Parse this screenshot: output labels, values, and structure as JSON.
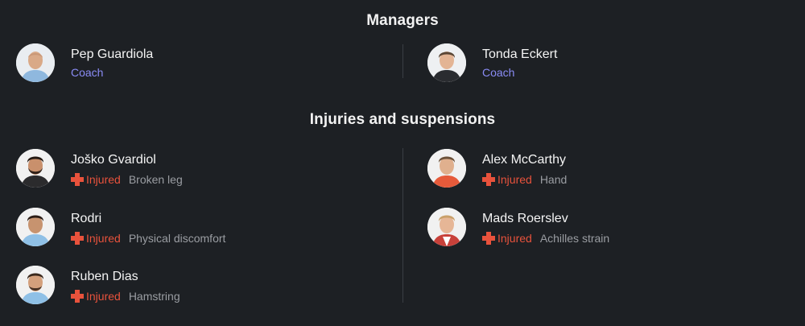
{
  "managers": {
    "title": "Managers",
    "left": {
      "name": "Pep Guardiola",
      "role": "Coach"
    },
    "right": {
      "name": "Tonda Eckert",
      "role": "Coach"
    }
  },
  "injuries": {
    "title": "Injuries and suspensions",
    "left": [
      {
        "name": "Joško Gvardiol",
        "status": "Injured",
        "reason": "Broken leg"
      },
      {
        "name": "Rodri",
        "status": "Injured",
        "reason": "Physical discomfort"
      },
      {
        "name": "Ruben Dias",
        "status": "Injured",
        "reason": "Hamstring"
      }
    ],
    "right": [
      {
        "name": "Alex McCarthy",
        "status": "Injured",
        "reason": "Hand"
      },
      {
        "name": "Mads Roerslev",
        "status": "Injured",
        "reason": "Achilles strain"
      }
    ]
  },
  "colors": {
    "background": "#1d2024",
    "role_accent": "#8a8cf5",
    "injured_red": "#e8523c",
    "reason_gray": "#9a9da2"
  },
  "icons": {
    "status": "medical-cross-icon",
    "avatar": "player-avatar"
  }
}
